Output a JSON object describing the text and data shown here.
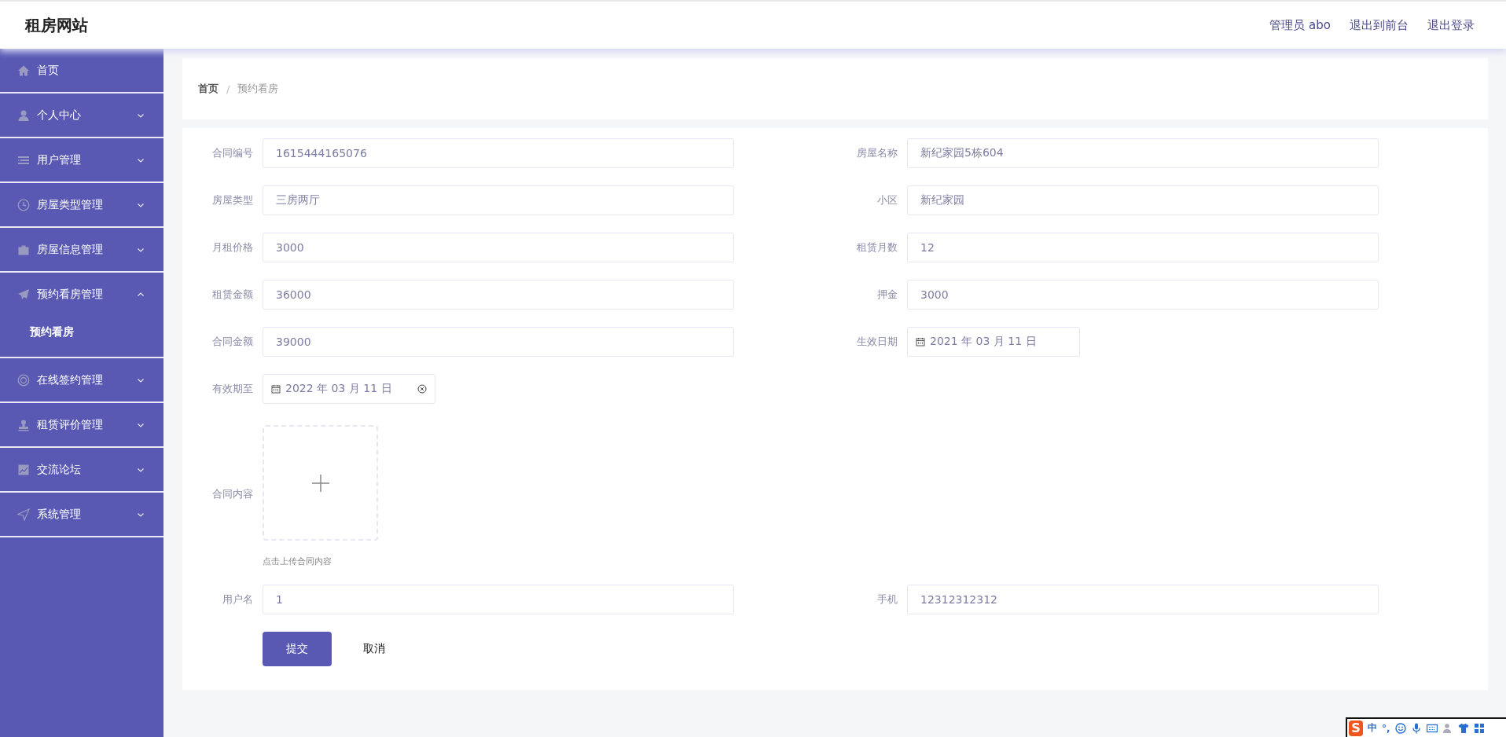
{
  "header": {
    "title": "租房网站",
    "links": [
      "管理员 abo",
      "退出到前台",
      "退出登录"
    ]
  },
  "sidebar": {
    "items": [
      {
        "label": "首页",
        "kind": "link"
      },
      {
        "label": "个人中心",
        "kind": "menu",
        "expanded": false
      },
      {
        "label": "用户管理",
        "kind": "menu",
        "expanded": false
      },
      {
        "label": "房屋类型管理",
        "kind": "menu",
        "expanded": false
      },
      {
        "label": "房屋信息管理",
        "kind": "menu",
        "expanded": false
      },
      {
        "label": "预约看房管理",
        "kind": "menu",
        "expanded": true,
        "children": [
          {
            "label": "预约看房",
            "selected": true
          }
        ]
      },
      {
        "label": "在线签约管理",
        "kind": "menu",
        "expanded": false
      },
      {
        "label": "租赁评价管理",
        "kind": "menu",
        "expanded": false
      },
      {
        "label": "交流论坛",
        "kind": "menu",
        "expanded": false
      },
      {
        "label": "系统管理",
        "kind": "menu",
        "expanded": false
      }
    ]
  },
  "breadcrumb": [
    "首页",
    "预约看房"
  ],
  "breadcrumb_separator": "/",
  "form": {
    "rows": [
      [
        {
          "label": "合同编号",
          "kind": "text",
          "value": "1615444165076"
        },
        {
          "label": "房屋名称",
          "kind": "text",
          "value": "新纪家园5栋604"
        }
      ],
      [
        {
          "label": "房屋类型",
          "kind": "text",
          "value": "三房两厅"
        },
        {
          "label": "小区",
          "kind": "text",
          "value": "新纪家园"
        }
      ],
      [
        {
          "label": "月租价格",
          "kind": "text",
          "value": "3000"
        },
        {
          "label": "租赁月数",
          "kind": "text",
          "value": "12"
        }
      ],
      [
        {
          "label": "租赁金额",
          "kind": "text",
          "value": "36000"
        },
        {
          "label": "押金",
          "kind": "text",
          "value": "3000"
        }
      ],
      [
        {
          "label": "合同金额",
          "kind": "text",
          "value": "39000"
        },
        {
          "label": "生效日期",
          "kind": "date",
          "value": "2021 年 03 月 11 日",
          "clearable": false
        }
      ],
      [
        {
          "label": "有效期至",
          "kind": "date",
          "value": "2022 年 03 月 11 日",
          "clearable": true
        }
      ],
      [
        {
          "label": "合同内容",
          "kind": "upload",
          "hint": "点击上传合同内容"
        }
      ],
      [
        {
          "label": "用户名",
          "kind": "text",
          "value": "1"
        },
        {
          "label": "手机",
          "kind": "text",
          "value": "12312312312"
        }
      ]
    ],
    "buttons": [
      {
        "label": "提交",
        "kind": "primary"
      },
      {
        "label": "取消",
        "kind": "plain"
      }
    ]
  },
  "ime": {
    "logo": "S",
    "texts": [
      "中",
      "°,"
    ]
  }
}
